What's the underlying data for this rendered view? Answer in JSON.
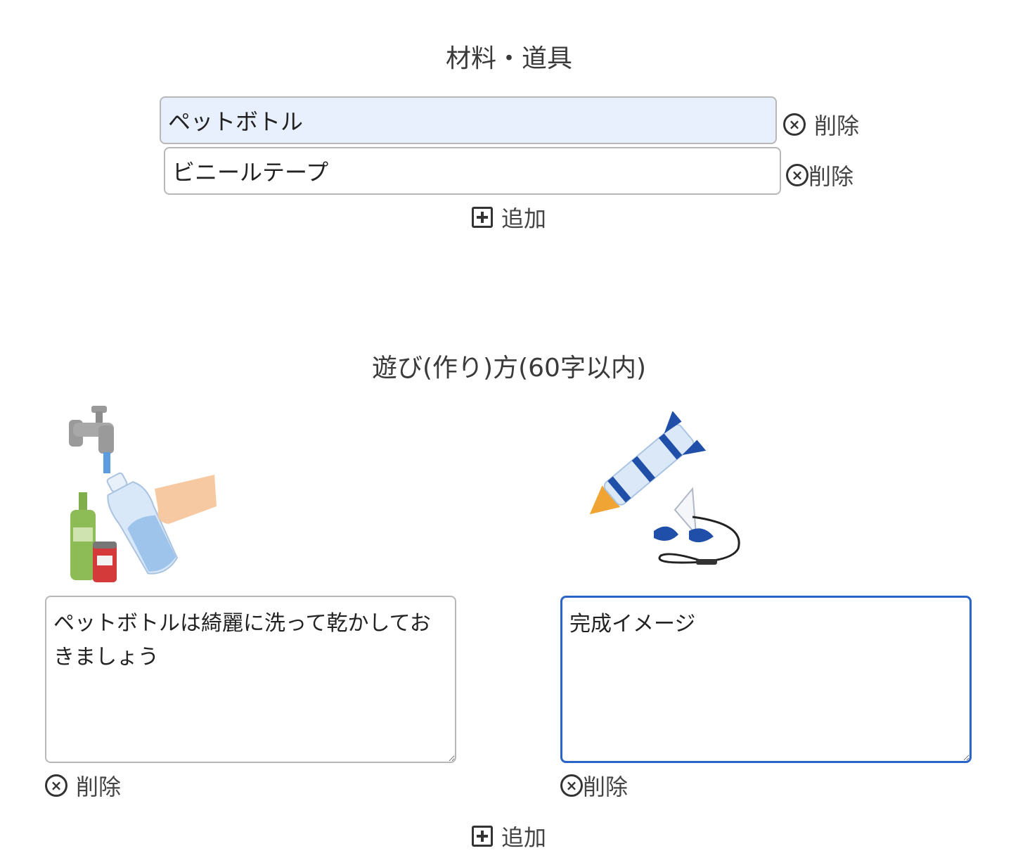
{
  "materials": {
    "title": "材料・道具",
    "items": [
      {
        "value": "ペットボトル",
        "delete_label": "削除"
      },
      {
        "value": "ビニールテープ",
        "delete_label": "削除"
      }
    ],
    "add_label": "追加"
  },
  "howto": {
    "title": "遊び(作り)方(60字以内)",
    "steps": [
      {
        "text": "ペットボトルは綺麗に洗って乾かしておきましょう",
        "delete_label": "削除"
      },
      {
        "text": "完成イメージ",
        "delete_label": "削除"
      }
    ],
    "add_label": "追加"
  },
  "icons": [
    "circle-x-icon",
    "plus-square-icon"
  ],
  "colors": {
    "autofill_bg": "#e8f0fe",
    "focus_border": "#2a64c8"
  }
}
